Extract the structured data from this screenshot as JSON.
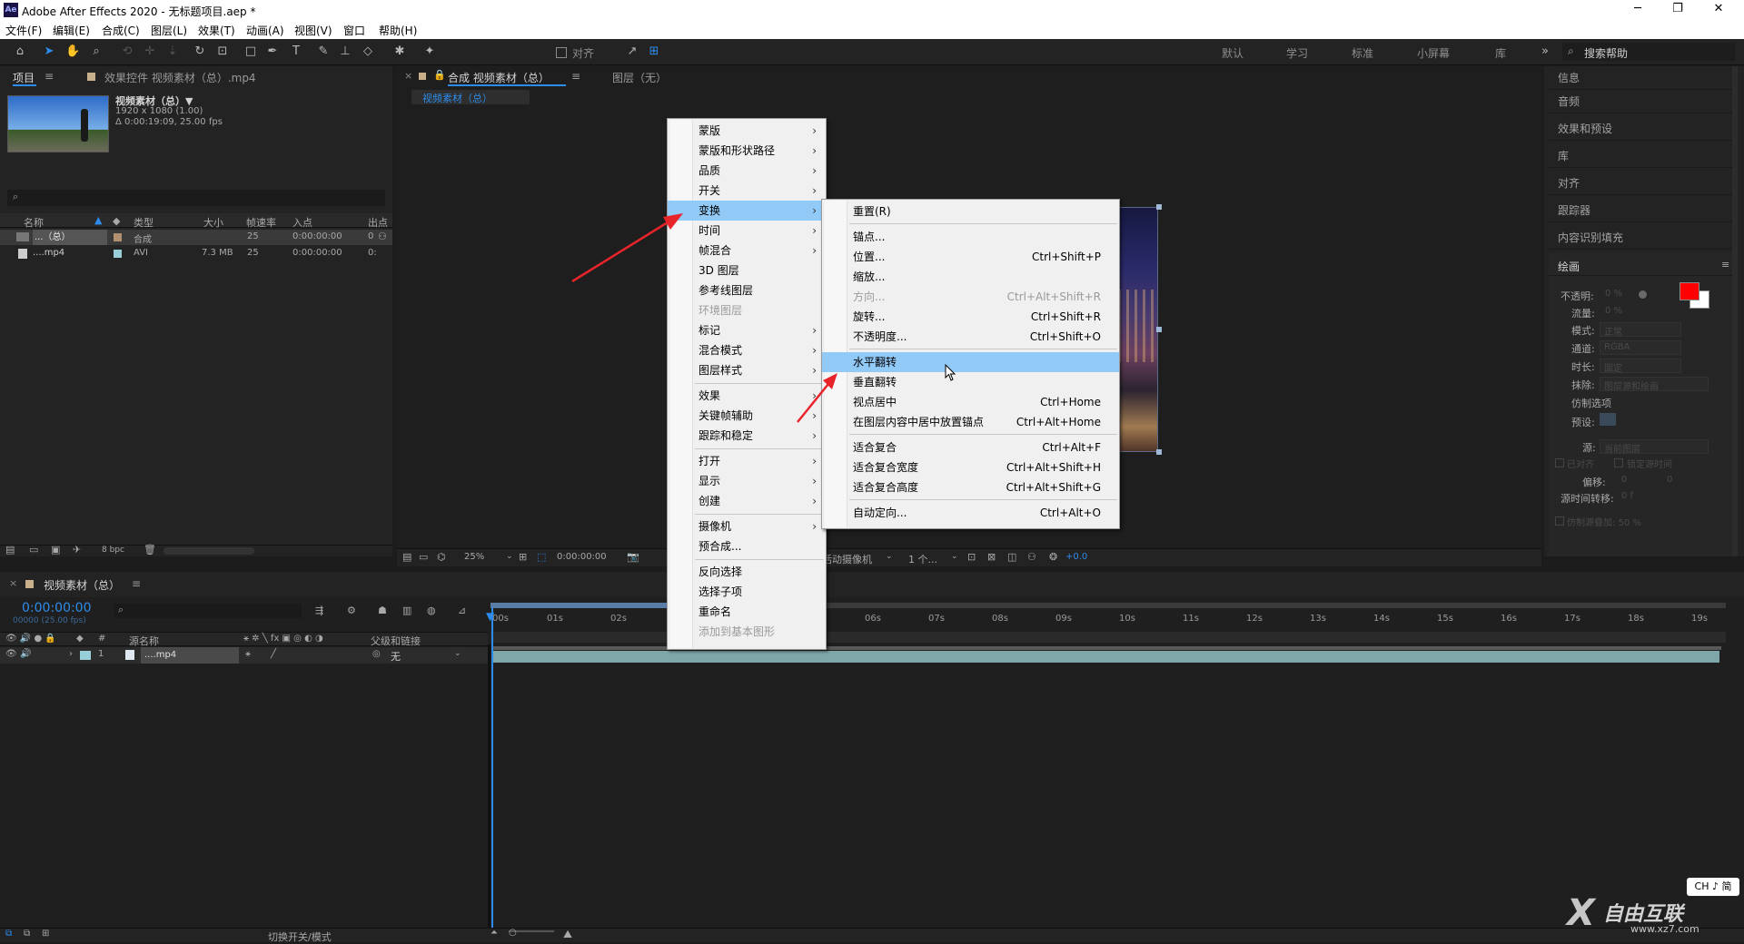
{
  "title": "Adobe After Effects 2020 - 无标题项目.aep *",
  "menubar": [
    "文件(F)",
    "编辑(E)",
    "合成(C)",
    "图层(L)",
    "效果(T)",
    "动画(A)",
    "视图(V)",
    "窗口",
    "帮助(H)"
  ],
  "toolbar": {
    "align_label": "对齐",
    "workspaces": [
      "默认",
      "学习",
      "标准",
      "小屏幕",
      "库"
    ],
    "search_placeholder": "搜索帮助"
  },
  "project_panel": {
    "tab_project": "项目",
    "tab_effects": "效果控件 视频素材（总）.mp4",
    "asset_name": "视频素材（总）▼",
    "asset_size": "1920 x 1080 (1.00)",
    "asset_duration": "Δ 0:00:19:09, 25.00 fps",
    "columns": [
      "名称",
      "类型",
      "大小",
      "帧速率",
      "入点",
      "出点"
    ],
    "rows": [
      {
        "name": "...（总）",
        "type": "合成",
        "size": "",
        "fps": "25",
        "in": "0:00:00:00",
        "out": "0"
      },
      {
        "name": "....mp4",
        "type": "AVI",
        "size": "7.3 MB",
        "fps": "25",
        "in": "0:00:00:00",
        "out": "0:"
      }
    ],
    "bpc": "8 bpc"
  },
  "comp_panel": {
    "tab": "合成 视频素材（总）",
    "layer_tab": "图层（无）",
    "breadcrumb": "视频素材（总）",
    "zoom": "25%",
    "time": "0:00:00:00",
    "camera": "活动摄像机",
    "views": "1 个...",
    "offset": "+0.0"
  },
  "context_menu": {
    "items": [
      {
        "label": "蒙版",
        "sub": true
      },
      {
        "label": "蒙版和形状路径",
        "sub": true
      },
      {
        "label": "品质",
        "sub": true
      },
      {
        "label": "开关",
        "sub": true
      },
      {
        "label": "变换",
        "sub": true,
        "highlight": true
      },
      {
        "label": "时间",
        "sub": true
      },
      {
        "label": "帧混合",
        "sub": true
      },
      {
        "label": "3D 图层"
      },
      {
        "label": "参考线图层"
      },
      {
        "label": "环境图层",
        "disabled": true
      },
      {
        "label": "标记",
        "sub": true
      },
      {
        "label": "混合模式",
        "sub": true
      },
      {
        "label": "图层样式",
        "sub": true
      },
      {
        "label": "效果",
        "sub": true
      },
      {
        "label": "关键帧辅助",
        "sub": true
      },
      {
        "label": "跟踪和稳定",
        "sub": true
      },
      {
        "label": "打开",
        "sub": true
      },
      {
        "label": "显示",
        "sub": true
      },
      {
        "label": "创建",
        "sub": true
      },
      {
        "label": "摄像机",
        "sub": true
      },
      {
        "label": "预合成..."
      },
      {
        "label": "反向选择"
      },
      {
        "label": "选择子项"
      },
      {
        "label": "重命名"
      },
      {
        "label": "添加到基本图形",
        "disabled": true
      }
    ]
  },
  "submenu": {
    "items": [
      {
        "label": "重置(R)",
        "shortcut": ""
      },
      {
        "label": "锚点...",
        "shortcut": ""
      },
      {
        "label": "位置...",
        "shortcut": "Ctrl+Shift+P"
      },
      {
        "label": "缩放...",
        "shortcut": ""
      },
      {
        "label": "方向...",
        "shortcut": "Ctrl+Alt+Shift+R",
        "disabled": true
      },
      {
        "label": "旋转...",
        "shortcut": "Ctrl+Shift+R"
      },
      {
        "label": "不透明度...",
        "shortcut": "Ctrl+Shift+O"
      },
      {
        "label": "水平翻转",
        "shortcut": "",
        "highlight": true
      },
      {
        "label": "垂直翻转",
        "shortcut": ""
      },
      {
        "label": "视点居中",
        "shortcut": "Ctrl+Home"
      },
      {
        "label": "在图层内容中居中放置锚点",
        "shortcut": "Ctrl+Alt+Home"
      },
      {
        "label": "适合复合",
        "shortcut": "Ctrl+Alt+F"
      },
      {
        "label": "适合复合宽度",
        "shortcut": "Ctrl+Alt+Shift+H"
      },
      {
        "label": "适合复合高度",
        "shortcut": "Ctrl+Alt+Shift+G"
      },
      {
        "label": "自动定向...",
        "shortcut": "Ctrl+Alt+O"
      }
    ]
  },
  "right_panel": {
    "items": [
      "信息",
      "音频",
      "效果和预设",
      "库",
      "对齐",
      "跟踪器",
      "内容识别填充"
    ],
    "paint_title": "绘画",
    "paint": {
      "opacity_label": "不透明:",
      "opacity": "0 %",
      "flow_label": "流量:",
      "flow": "0 %",
      "mode_label": "模式:",
      "mode": "正常",
      "channel_label": "通道:",
      "channel": "RGBA",
      "duration_label": "时长:",
      "duration": "固定",
      "erase_label": "抹除:",
      "erase": "图层源和绘画",
      "clone_title": "仿制选项",
      "preset_label": "预设:",
      "source_label": "源:",
      "source": "当前图层",
      "aligned": "已对齐",
      "lock_time": "锁定源时间",
      "offset_label": "偏移:",
      "offset_x": "0",
      "offset_y": "0",
      "time_shift_label": "源时间转移:",
      "time_shift": "0 f",
      "overlay": "仿制源叠加: 50 %"
    },
    "colors": {
      "foreground": "#ff0000",
      "background": "#ffffff"
    }
  },
  "timeline": {
    "tab": "视频素材（总）",
    "timecode": "0:00:00:00",
    "frames": "00000 (25.00 fps)",
    "col_source": "源名称",
    "col_parent": "父级和链接",
    "layer_index": "1",
    "layer_name": "....mp4",
    "parent": "无",
    "ruler": [
      "00s",
      "01s",
      "02s",
      "06s",
      "07s",
      "08s",
      "09s",
      "10s",
      "11s",
      "12s",
      "13s",
      "14s",
      "15s",
      "16s",
      "17s",
      "18s",
      "19s"
    ],
    "switch_modes": "切换开关/模式"
  },
  "ime": "CH ♪ 简",
  "watermark": {
    "brand": "自由互联",
    "url": "www.xz7.com"
  }
}
